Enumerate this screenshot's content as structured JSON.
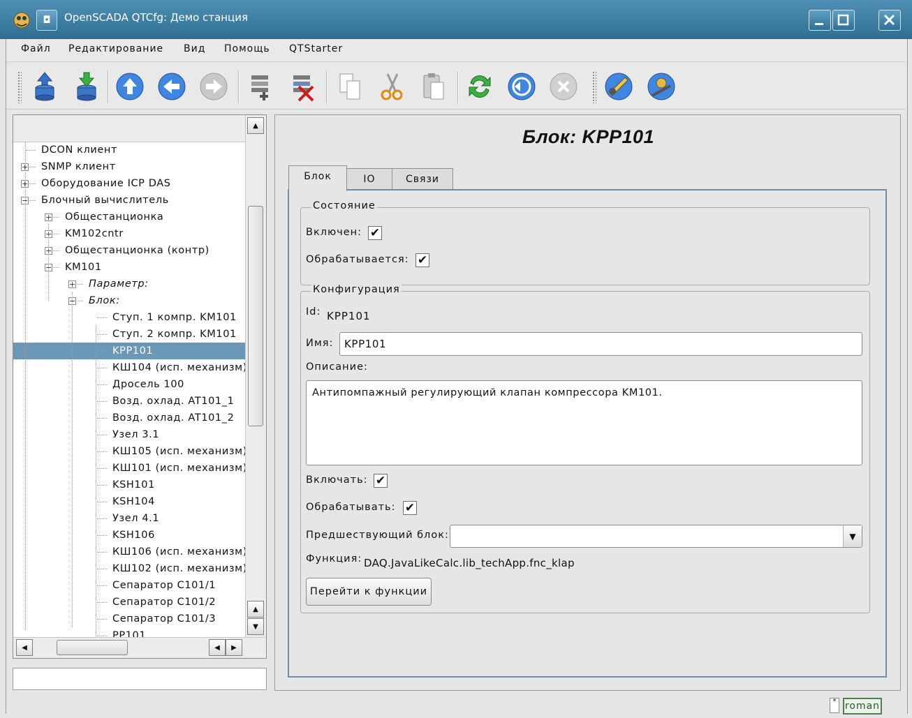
{
  "window": {
    "title": "OpenSCADA QTCfg: Демо станция"
  },
  "menu": {
    "file": "Файл",
    "edit": "Редактирование",
    "view": "Вид",
    "help": "Помощь",
    "starter": "QTStarter"
  },
  "tree": {
    "items": [
      {
        "label": "DCON клиент",
        "level": 0,
        "expander": "none"
      },
      {
        "label": "SNMP клиент",
        "level": 0,
        "expander": "plus"
      },
      {
        "label": "Оборудование ICP DAS",
        "level": 0,
        "expander": "plus"
      },
      {
        "label": "Блочный вычислитель",
        "level": 0,
        "expander": "minus"
      },
      {
        "label": "Общестанционка",
        "level": 1,
        "expander": "plus"
      },
      {
        "label": "KM102cntr",
        "level": 1,
        "expander": "plus"
      },
      {
        "label": "Общестанционка (контр)",
        "level": 1,
        "expander": "plus"
      },
      {
        "label": "KM101",
        "level": 1,
        "expander": "minus"
      },
      {
        "label": "Параметр:",
        "level": 2,
        "expander": "plus",
        "italic": true
      },
      {
        "label": "Блок:",
        "level": 2,
        "expander": "minus",
        "italic": true
      },
      {
        "label": "Ступ. 1 компр. KM101",
        "level": 3,
        "expander": "none"
      },
      {
        "label": "Ступ. 2 компр. KM101",
        "level": 3,
        "expander": "none"
      },
      {
        "label": "KPP101",
        "level": 3,
        "expander": "none",
        "selected": true
      },
      {
        "label": "КШ104 (исп. механизм)",
        "level": 3,
        "expander": "none"
      },
      {
        "label": "Дросель 100",
        "level": 3,
        "expander": "none"
      },
      {
        "label": "Возд. охлад. AT101_1",
        "level": 3,
        "expander": "none"
      },
      {
        "label": "Возд. охлад. AT101_2",
        "level": 3,
        "expander": "none"
      },
      {
        "label": "Узел 3.1",
        "level": 3,
        "expander": "none"
      },
      {
        "label": "КШ105 (исп. механизм)",
        "level": 3,
        "expander": "none"
      },
      {
        "label": "КШ101 (исп. механизм)",
        "level": 3,
        "expander": "none"
      },
      {
        "label": "KSH101",
        "level": 3,
        "expander": "none"
      },
      {
        "label": "KSH104",
        "level": 3,
        "expander": "none"
      },
      {
        "label": "Узел 4.1",
        "level": 3,
        "expander": "none"
      },
      {
        "label": "KSH106",
        "level": 3,
        "expander": "none"
      },
      {
        "label": "КШ106 (исп. механизм)",
        "level": 3,
        "expander": "none"
      },
      {
        "label": "КШ102 (исп. механизм)",
        "level": 3,
        "expander": "none"
      },
      {
        "label": "Сепаратор C101/1",
        "level": 3,
        "expander": "none"
      },
      {
        "label": "Сепаратор C101/2",
        "level": 3,
        "expander": "none"
      },
      {
        "label": "Сепаратор C101/3",
        "level": 3,
        "expander": "none"
      },
      {
        "label": "PP101",
        "level": 3,
        "expander": "none"
      }
    ]
  },
  "panel": {
    "title": "Блок: KPP101",
    "tabs": [
      {
        "label": "Блок",
        "active": true
      },
      {
        "label": "IO",
        "active": false
      },
      {
        "label": "Связи",
        "active": false
      }
    ]
  },
  "state": {
    "group_label": "Состояние",
    "enabled_label": "Включен:",
    "enabled": true,
    "processing_label": "Обрабатывается:",
    "processing": true
  },
  "config": {
    "group_label": "Конфигурация",
    "id_label": "Id:",
    "id_value": "KPP101",
    "name_label": "Имя:",
    "name_value": "KPP101",
    "descr_label": "Описание:",
    "descr_value": "Антипомпажный регулирующий клапан компрессора KM101.",
    "to_enable_label": "Включать:",
    "to_enable": true,
    "to_process_label": "Обрабатывать:",
    "to_process": true,
    "prev_block_label": "Предшествующий блок:",
    "prev_block_value": "",
    "func_label": "Функция:",
    "func_value": "DAQ.JavaLikeCalc.lib_techApp.fnc_klap",
    "goto_func_label": "Перейти к функции"
  },
  "status": {
    "user": "roman",
    "indicator": "*"
  },
  "colors": {
    "titlebar": "#3a7ca0",
    "selection": "#6b98b8",
    "tabpane_border": "#6d8fa6"
  }
}
